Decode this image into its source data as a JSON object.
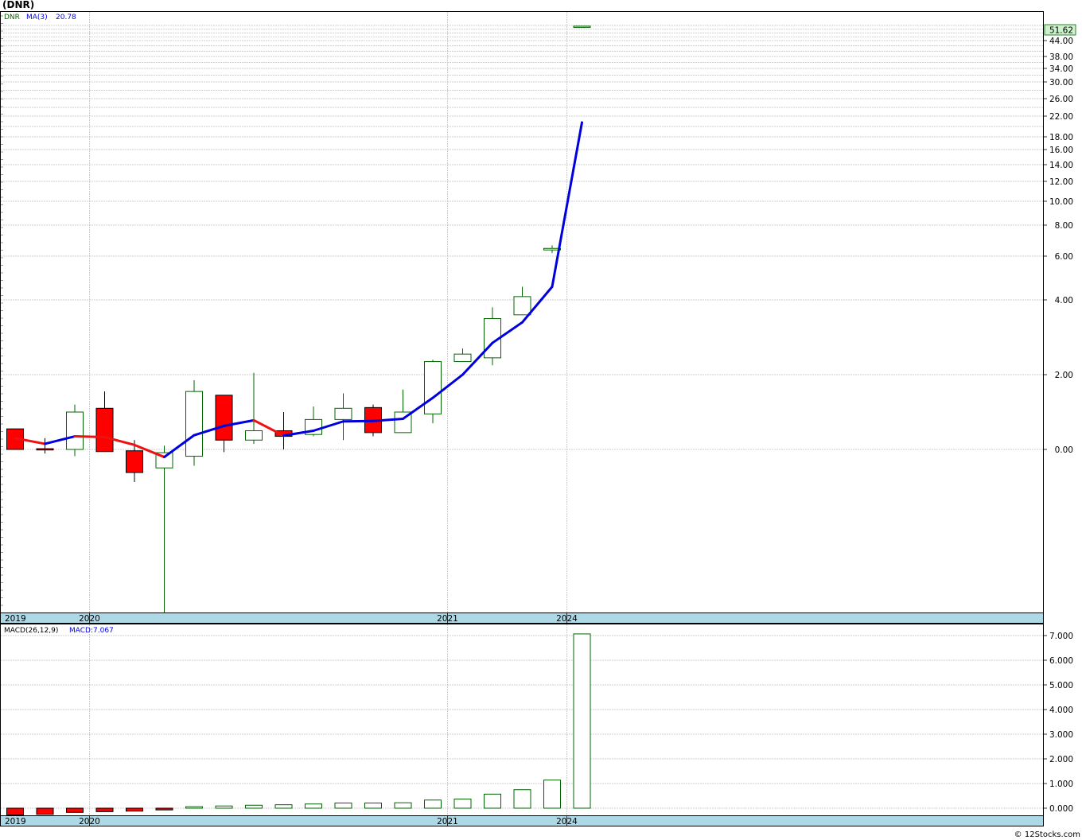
{
  "title": "(DNR)",
  "credit": "© 12Stocks.com",
  "colors": {
    "up_body": "#ffffff",
    "up_stroke": "#006400",
    "down_body": "#ff0000",
    "ma_up": "#0000dd",
    "ma_down": "#ee1111",
    "axis_band": "#add8e6",
    "grid": "#c0c0c0",
    "last_price_bg": "#ccf2cc"
  },
  "chart_data": [
    {
      "type": "candlestick",
      "legend": {
        "symbol": "DNR",
        "ma_label": "MA(3)",
        "ma_value": "20.78"
      },
      "last_price": "51.62",
      "y_tick_labels": [
        "44.00",
        "38.00",
        "34.00",
        "30.00",
        "26.00",
        "22.00",
        "18.00",
        "16.00",
        "14.00",
        "12.00",
        "10.00",
        "8.00",
        "6.00",
        "4.00",
        "2.00",
        "0.00"
      ],
      "y_tick_values": [
        44,
        38,
        34,
        30,
        26,
        22,
        18,
        16,
        14,
        12,
        10,
        8,
        6,
        4,
        2,
        0
      ],
      "y_gridlines": [
        52,
        50,
        48,
        46,
        44,
        42,
        40,
        38,
        36,
        34,
        32,
        30,
        28,
        26,
        24,
        22,
        20,
        18,
        16,
        14,
        12,
        10,
        8,
        6,
        4,
        2,
        0
      ],
      "x_labels": [
        {
          "label": "2019",
          "index": -0.6
        },
        {
          "label": "2020",
          "index": 3
        },
        {
          "label": "2021",
          "index": 15
        },
        {
          "label": "2024",
          "index": 19
        }
      ],
      "candles": [
        {
          "o": 0.55,
          "h": 0.55,
          "l": 0.0,
          "c": 0.0
        },
        {
          "o": 0.02,
          "h": 0.3,
          "l": -0.15,
          "c": -0.02
        },
        {
          "o": 0.0,
          "h": 1.2,
          "l": -0.25,
          "c": 1.0
        },
        {
          "o": 1.1,
          "h": 1.55,
          "l": -0.05,
          "c": -0.08
        },
        {
          "o": -0.05,
          "h": 0.25,
          "l": -1.2,
          "c": -0.85
        },
        {
          "o": -0.68,
          "h": 0.1,
          "l": -6.0,
          "c": -0.12
        },
        {
          "o": -0.25,
          "h": 1.85,
          "l": -0.6,
          "c": 1.55
        },
        {
          "o": 1.45,
          "h": 1.45,
          "l": -0.1,
          "c": 0.25
        },
        {
          "o": 0.25,
          "h": 2.05,
          "l": 0.15,
          "c": 0.5
        },
        {
          "o": 0.5,
          "h": 1.0,
          "l": 0.0,
          "c": 0.35
        },
        {
          "o": 0.4,
          "h": 1.15,
          "l": 0.35,
          "c": 0.8
        },
        {
          "o": 0.8,
          "h": 1.5,
          "l": 0.25,
          "c": 1.1
        },
        {
          "o": 1.12,
          "h": 1.2,
          "l": 0.35,
          "c": 0.45
        },
        {
          "o": 0.45,
          "h": 1.6,
          "l": 0.45,
          "c": 1.0
        },
        {
          "o": 0.95,
          "h": 2.4,
          "l": 0.7,
          "c": 2.35
        },
        {
          "o": 2.35,
          "h": 2.7,
          "l": 2.35,
          "c": 2.55
        },
        {
          "o": 2.45,
          "h": 3.8,
          "l": 2.25,
          "c": 3.5
        },
        {
          "o": 3.6,
          "h": 4.6,
          "l": 3.6,
          "c": 4.15
        },
        {
          "o": 6.4,
          "h": 6.7,
          "l": 6.2,
          "c": 6.5
        },
        {
          "o": 51.62,
          "h": 51.62,
          "l": 51.62,
          "c": 51.62
        }
      ],
      "ma": [
        0.3,
        0.15,
        0.35,
        0.33,
        0.12,
        -0.28,
        0.38,
        0.63,
        0.78,
        0.37,
        0.5,
        0.75,
        0.76,
        0.82,
        1.38,
        2.0,
        2.85,
        3.4,
        4.6,
        20.78
      ]
    },
    {
      "type": "bar",
      "legend": {
        "name": "MACD(26,12,9)",
        "value_label": "MACD:7.067"
      },
      "y_tick_labels": [
        "7.000",
        "6.000",
        "5.000",
        "4.000",
        "3.000",
        "2.000",
        "1.000",
        "0.000"
      ],
      "y_tick_values": [
        7,
        6,
        5,
        4,
        3,
        2,
        1,
        0
      ],
      "x_labels": [
        {
          "label": "2019",
          "index": -0.6
        },
        {
          "label": "2020",
          "index": 3
        },
        {
          "label": "2021",
          "index": 15
        },
        {
          "label": "2024",
          "index": 19
        }
      ],
      "values": [
        -0.28,
        -0.25,
        -0.17,
        -0.14,
        -0.12,
        -0.07,
        0.06,
        0.09,
        0.12,
        0.14,
        0.17,
        0.21,
        0.21,
        0.22,
        0.33,
        0.37,
        0.57,
        0.75,
        1.14,
        7.067
      ]
    }
  ]
}
